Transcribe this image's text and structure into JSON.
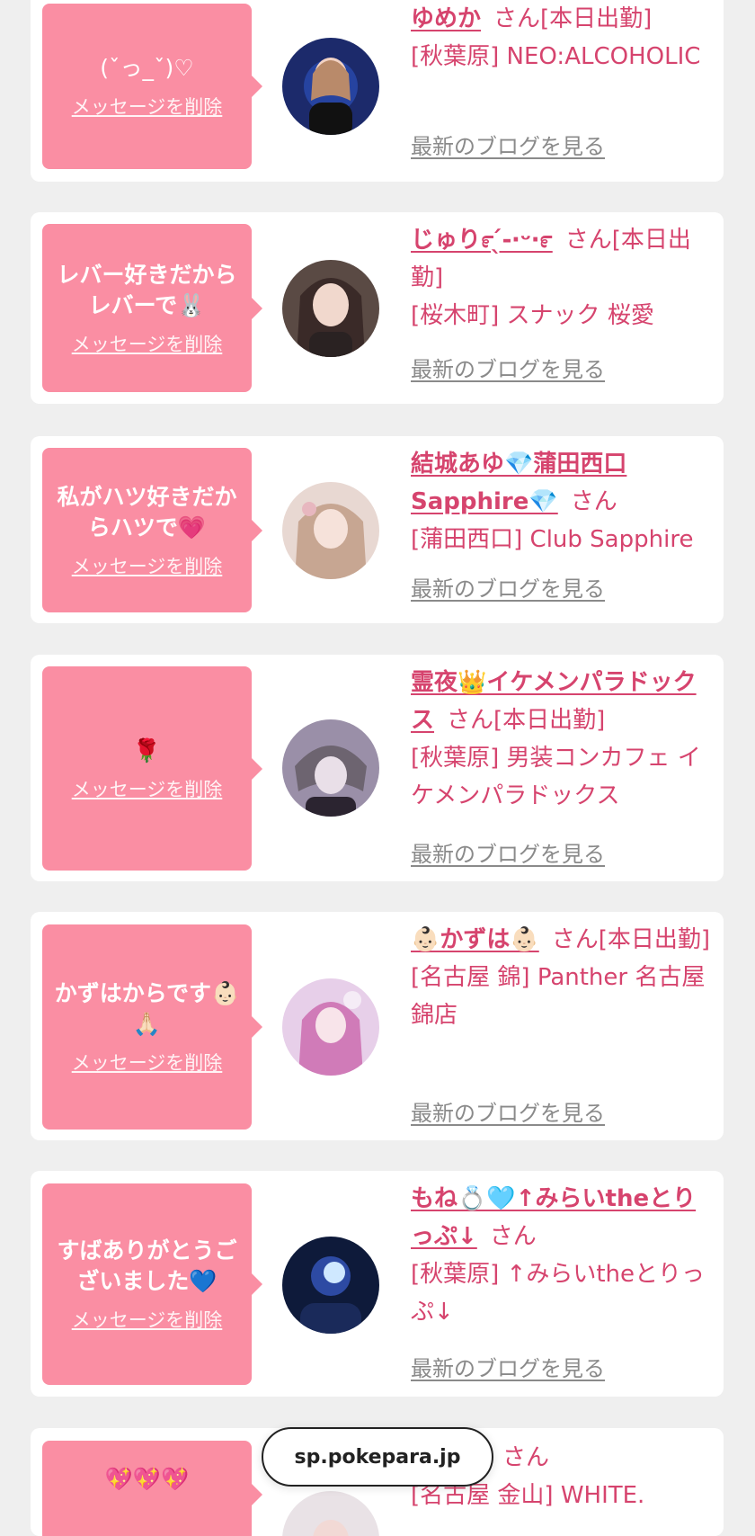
{
  "colors": {
    "accent": "#d6446e",
    "message_bg": "#fa8ea3",
    "card_bg": "#ffffff",
    "page_bg": "#efefef",
    "blog_link": "#8a8a8a"
  },
  "cards": [
    {
      "message": "(ˇっ_ˇ)♡",
      "delete_label": "メッセージを削除",
      "cast_name": "ゆめか",
      "honorific": "さん",
      "today_label": "[本日出勤]",
      "shop": "[秋葉原] NEO:ALCOHOLIC",
      "blog_label": "最新のブログを見る",
      "avatar_icon": "avatar-photo"
    },
    {
      "message": "レバー好きだから\nレバーで🐰",
      "delete_label": "メッセージを削除",
      "cast_name": "じゅり೯ ̖́-‧ᵕ‧೯",
      "honorific": "さん",
      "today_label": "[本日出勤]",
      "shop": "[桜木町] スナック 桜愛",
      "blog_label": "最新のブログを見る",
      "avatar_icon": "avatar-photo"
    },
    {
      "message": "私がハツ好きだか\nらハツで💗",
      "delete_label": "メッセージを削除",
      "cast_name": "結城あゆ💎蒲田西口Sapphire💎",
      "honorific": "さん",
      "today_label": "",
      "shop": "[蒲田西口] Club Sapphire",
      "blog_label": "最新のブログを見る",
      "avatar_icon": "avatar-photo"
    },
    {
      "message": "🌹",
      "delete_label": "メッセージを削除",
      "cast_name": "霊夜👑イケメンパラドックス",
      "honorific": "さん",
      "today_label": "[本日出勤]",
      "shop": "[秋葉原] 男装コンカフェ イケメンパラドックス",
      "blog_label": "最新のブログを見る",
      "avatar_icon": "avatar-photo"
    },
    {
      "message": "かずはからです👶🏻\n🙏🏻",
      "delete_label": "メッセージを削除",
      "cast_name": "👶🏻かずは👶🏻",
      "honorific": "さん",
      "today_label": "[本日出勤]",
      "shop": "[名古屋 錦] Panther 名古屋錦店",
      "blog_label": "最新のブログを見る",
      "avatar_icon": "avatar-photo"
    },
    {
      "message": "すばありがとうご\nざいました💙",
      "delete_label": "メッセージを削除",
      "cast_name": "もね💍🩵↑みらいtheとりっぷ↓",
      "honorific": "さん",
      "today_label": "",
      "shop": "[秋葉原] ↑みらいtheとりっぷ↓",
      "blog_label": "最新のブログを見る",
      "avatar_icon": "avatar-photo"
    },
    {
      "message": "💖💖💖",
      "delete_label": "",
      "cast_name": "",
      "honorific": "さん",
      "today_label": "",
      "shop": "[名古屋 金山] WHITE.",
      "blog_label": "",
      "avatar_icon": "avatar-photo"
    }
  ],
  "browser": {
    "url": "sp.pokepara.jp"
  }
}
